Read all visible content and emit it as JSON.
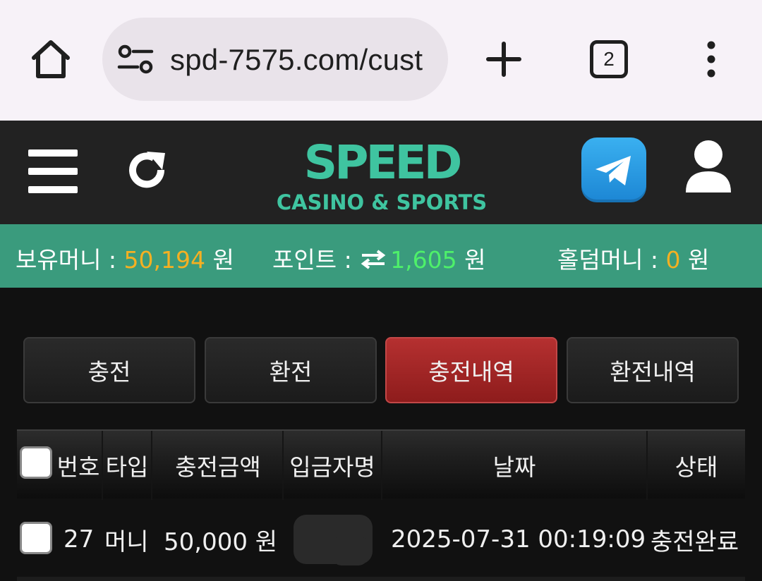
{
  "browser": {
    "url": "spd-7575.com/cust",
    "tab_count": "2"
  },
  "header": {
    "logo_text": "SPEED",
    "logo_subtitle": "CASINO & SPORTS"
  },
  "balance": {
    "money_label": "보유머니 : ",
    "money_value": "50,194",
    "money_unit": " 원",
    "point_label": "포인트 : ",
    "point_value": "1,605",
    "point_unit": " 원",
    "holdem_label": "홀덤머니 : ",
    "holdem_value": "0",
    "holdem_unit": " 원"
  },
  "tabs": [
    {
      "label": "충전",
      "active": false
    },
    {
      "label": "환전",
      "active": false
    },
    {
      "label": "충전내역",
      "active": true
    },
    {
      "label": "환전내역",
      "active": false
    }
  ],
  "table": {
    "headers": [
      "번호",
      "타입",
      "충전금액",
      "입금자명",
      "날짜",
      "상태"
    ],
    "rows": [
      {
        "number": "27",
        "type": "머니",
        "amount": "50,000 원",
        "depositor": "",
        "date": "2025-07-31 00:19:09",
        "status": "충전완료"
      }
    ]
  },
  "colors": {
    "accent_green": "#3a9b7d",
    "active_tab": "#b53030",
    "gold": "#f5b022",
    "point_green": "#4ef06a"
  },
  "icons": [
    "home-icon",
    "site-settings-icon",
    "plus-icon",
    "tabs-icon",
    "more-vert-icon",
    "hamburger-icon",
    "refresh-icon",
    "telegram-icon",
    "user-icon",
    "swap-icon"
  ]
}
